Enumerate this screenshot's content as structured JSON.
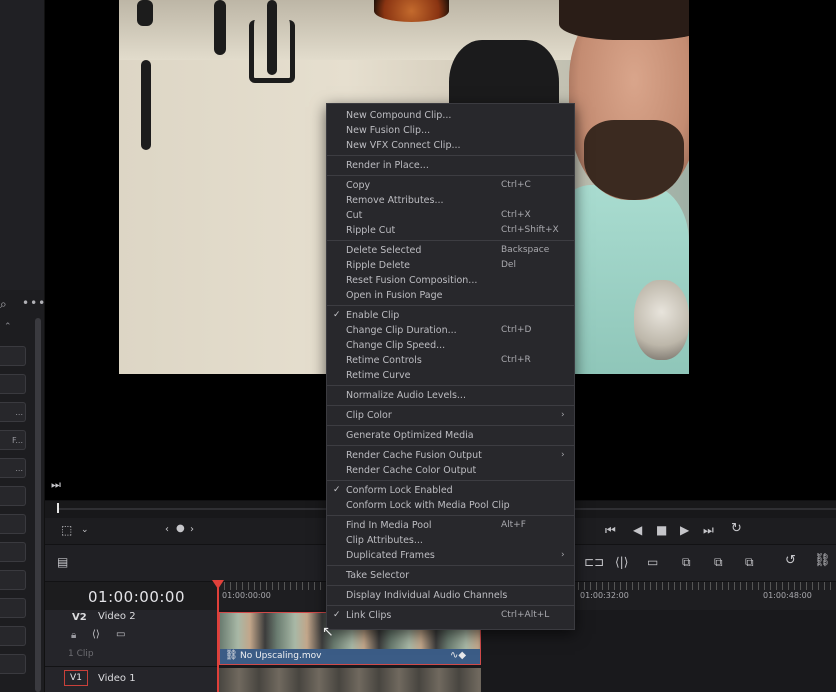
{
  "timeline": {
    "timecode": "01:00:00:00",
    "ruler": [
      "01:00:00:00",
      "01:00:32:00",
      "01:00:48:00"
    ],
    "tracks": [
      {
        "badge": "V2",
        "name": "Video 2",
        "info": "1 Clip"
      },
      {
        "badge": "V1",
        "name": "Video 1"
      }
    ],
    "clip_name": "No Upscaling.mov"
  },
  "left_panel": {
    "buttons": [
      "...",
      "F...",
      "..."
    ]
  },
  "icons": {
    "link": "link-icon",
    "lock": "lock-icon",
    "play": "play-icon",
    "stop": "stop-icon"
  },
  "menu": {
    "items": [
      {
        "label": "New Compound Clip..."
      },
      {
        "label": "New Fusion Clip..."
      },
      {
        "label": "New VFX Connect Clip..."
      },
      {
        "sep": true
      },
      {
        "label": "Render in Place..."
      },
      {
        "sep": true
      },
      {
        "label": "Copy",
        "shortcut": "Ctrl+C"
      },
      {
        "label": "Remove Attributes..."
      },
      {
        "label": "Cut",
        "shortcut": "Ctrl+X"
      },
      {
        "label": "Ripple Cut",
        "shortcut": "Ctrl+Shift+X"
      },
      {
        "sep": true
      },
      {
        "label": "Delete Selected",
        "shortcut": "Backspace"
      },
      {
        "label": "Ripple Delete",
        "shortcut": "Del"
      },
      {
        "label": "Reset Fusion Composition..."
      },
      {
        "label": "Open in Fusion Page"
      },
      {
        "sep": true
      },
      {
        "label": "Enable Clip",
        "checked": true
      },
      {
        "label": "Change Clip Duration...",
        "shortcut": "Ctrl+D"
      },
      {
        "label": "Change Clip Speed..."
      },
      {
        "label": "Retime Controls",
        "shortcut": "Ctrl+R"
      },
      {
        "label": "Retime Curve"
      },
      {
        "sep": true
      },
      {
        "label": "Normalize Audio Levels..."
      },
      {
        "sep": true
      },
      {
        "label": "Clip Color",
        "submenu": true
      },
      {
        "sep": true
      },
      {
        "label": "Generate Optimized Media"
      },
      {
        "sep": true
      },
      {
        "label": "Render Cache Fusion Output",
        "submenu": true
      },
      {
        "label": "Render Cache Color Output"
      },
      {
        "sep": true
      },
      {
        "label": "Conform Lock Enabled",
        "checked": true
      },
      {
        "label": "Conform Lock with Media Pool Clip"
      },
      {
        "sep": true
      },
      {
        "label": "Find In Media Pool",
        "shortcut": "Alt+F"
      },
      {
        "label": "Clip Attributes..."
      },
      {
        "label": "Duplicated Frames",
        "submenu": true
      },
      {
        "sep": true
      },
      {
        "label": "Take Selector"
      },
      {
        "sep": true
      },
      {
        "label": "Display Individual Audio Channels"
      },
      {
        "sep": true
      },
      {
        "label": "Link Clips",
        "checked": true,
        "shortcut": "Ctrl+Alt+L"
      }
    ]
  }
}
